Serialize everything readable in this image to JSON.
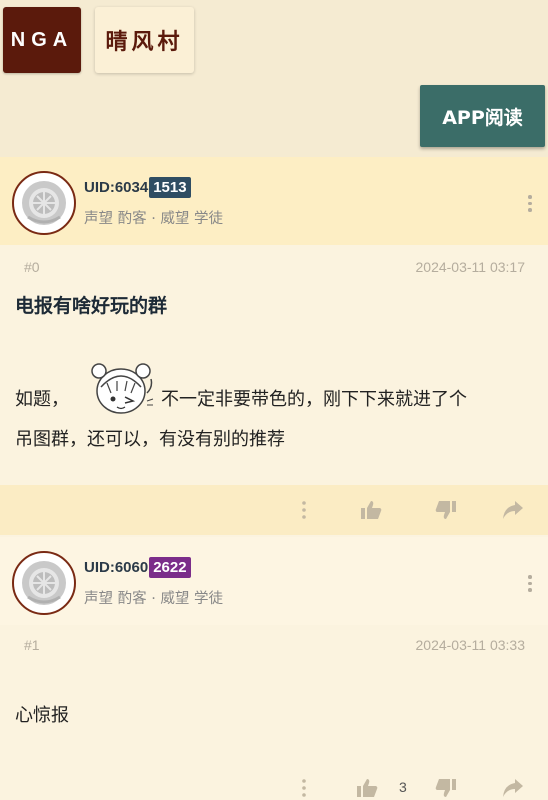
{
  "header": {
    "logo": "NGA",
    "forum": "晴风村",
    "app_button": "APP阅读"
  },
  "posts": [
    {
      "uid": "UID:6034",
      "badge": "1513",
      "badge_color": "#2f4d63",
      "reputation": "声望 酌客 · 威望 学徒",
      "floor": "#0",
      "time": "2024-03-11 03:17",
      "title": "电报有啥好玩的群",
      "content_before_emoji": "如题，",
      "content_after_emoji": "不一定非要带色的，刚下下来就进了个",
      "content_line2": "吊图群，还可以，有没有别的推荐",
      "like_count": ""
    },
    {
      "uid": "UID:6060",
      "badge": "2622",
      "badge_color": "#7b2d8a",
      "reputation": "声望 酌客 · 威望 学徒",
      "floor": "#1",
      "time": "2024-03-11 03:33",
      "content": "心惊报",
      "like_count": "3"
    }
  ],
  "icons": [
    "avatar-placeholder-icon",
    "more-vertical-icon",
    "thumbs-up-icon",
    "thumbs-down-icon",
    "share-icon",
    "anime-emoji"
  ]
}
